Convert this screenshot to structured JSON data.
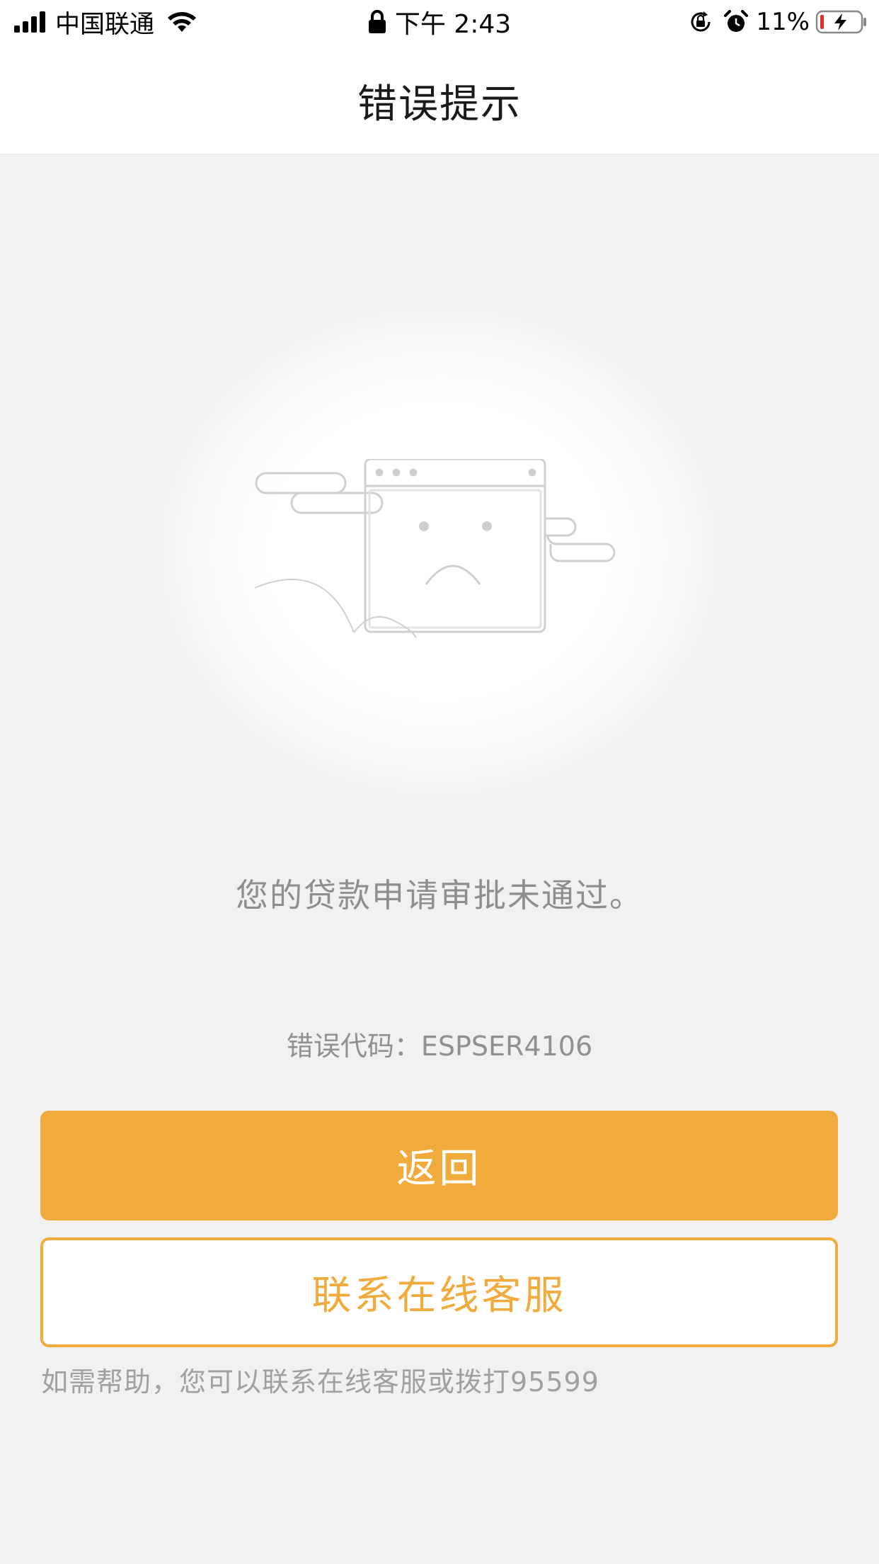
{
  "status_bar": {
    "carrier": "中国联通",
    "time": "下午 2:43",
    "battery_percent": "11%",
    "icons": [
      "signal-icon",
      "wifi-icon",
      "lock-icon",
      "orientation-lock-icon",
      "alarm-icon",
      "battery-charging-icon"
    ],
    "battery_low_color": "#e0302a"
  },
  "nav": {
    "title": "错误提示"
  },
  "main": {
    "illustration": "sad-browser-window-icon",
    "message": "您的贷款申请审批未通过。",
    "error_code": "错误代码：ESPSER4106"
  },
  "actions": {
    "back_label": "返回",
    "service_label": "联系在线客服"
  },
  "footer": {
    "help_text": "如需帮助，您可以联系在线客服或拨打95599"
  },
  "colors": {
    "accent": "#f0ab3c",
    "background": "#f1f1f1",
    "text_muted": "#8e8e8e"
  }
}
